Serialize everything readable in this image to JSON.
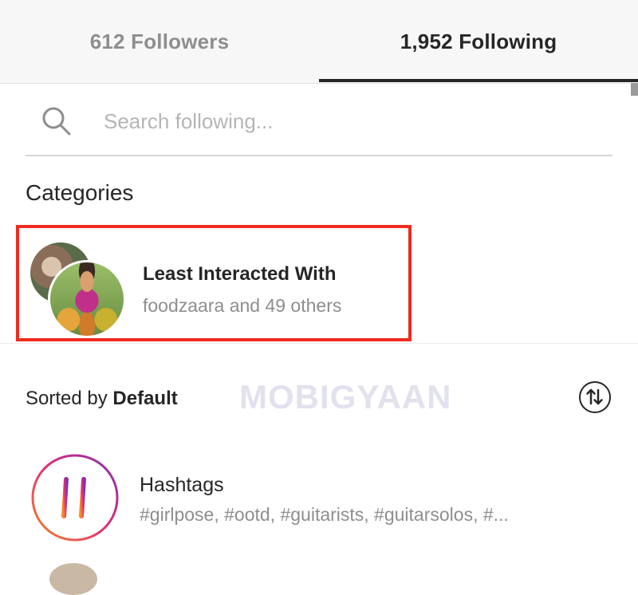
{
  "tabs": {
    "followers_label": "612 Followers",
    "following_label": "1,952 Following",
    "active": "following"
  },
  "search": {
    "placeholder": "Search following...",
    "value": "",
    "icon": "search-icon"
  },
  "categories": {
    "title": "Categories",
    "items": [
      {
        "title": "Least Interacted With",
        "subtitle": "foodzaara and 49 others",
        "highlight_color": "#ef2b1f"
      }
    ]
  },
  "sort": {
    "prefix": "Sorted by ",
    "value": "Default",
    "icon": "sort-arrows-icon"
  },
  "watermark": "MOBIGYAAN",
  "list": [
    {
      "title": "Hashtags",
      "subtitle": "#girlpose, #ootd, #guitarists, #guitarsolos, #...",
      "icon": "hashtag-icon"
    }
  ],
  "colors": {
    "text_primary": "#262626",
    "text_secondary": "#8e8e8e",
    "highlight": "#ef2b1f",
    "gradient_start": "#f58529",
    "gradient_mid": "#dd2a7b",
    "gradient_end": "#8134af"
  }
}
